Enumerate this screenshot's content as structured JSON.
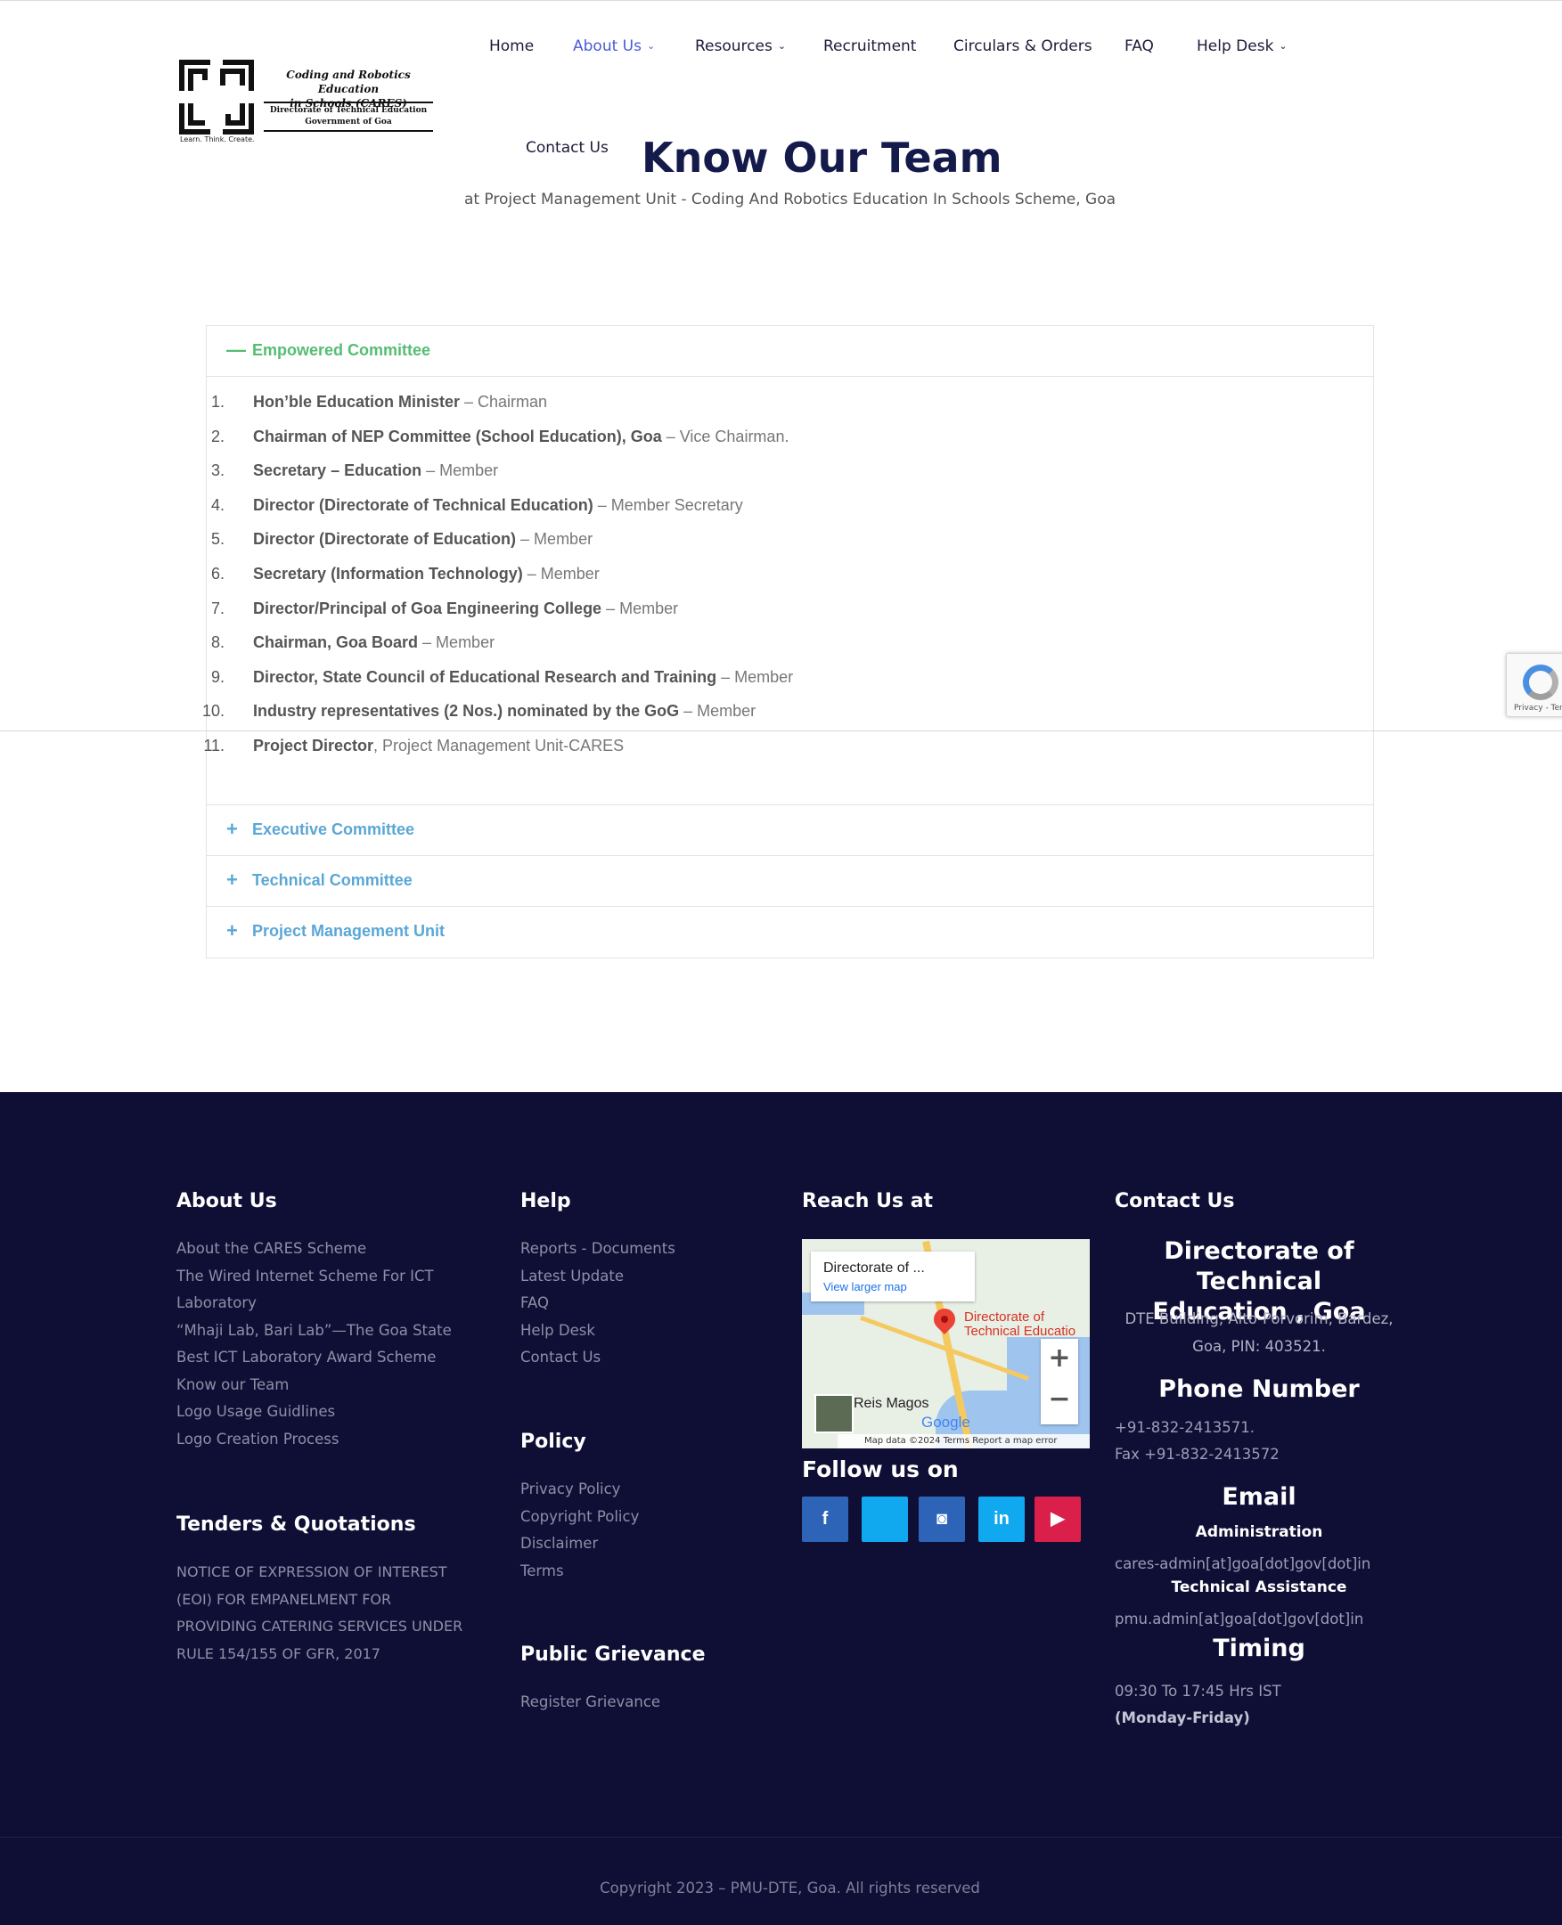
{
  "logo": {
    "title_line1": "Coding and Robotics Education",
    "title_line2": "in Schools (CARES)",
    "sub_line1": "Directorate of Technical Education",
    "sub_line2": "Government of Goa",
    "tagline": "Learn. Think. Create."
  },
  "nav": {
    "home": "Home",
    "about": "About Us",
    "resources": "Resources",
    "recruitment": "Recruitment",
    "circulars": "Circulars & Orders",
    "faq": "FAQ",
    "helpdesk": "Help Desk",
    "contact": "Contact Us",
    "active_color": "#4a5bd4"
  },
  "hero": {
    "title": "Know Our Team",
    "subtitle": "at Project Management Unit - Coding And Robotics Education In Schools Scheme, Goa"
  },
  "accordion": {
    "open_panel": {
      "title": "Empowered Committee",
      "icon": "minus-icon",
      "items": [
        {
          "num": "1.",
          "role": "Hon’ble Education Minister",
          "desc": " – Chairman"
        },
        {
          "num": "2.",
          "role": "Chairman of NEP Committee (School Education), Goa",
          "desc": " – Vice Chairman."
        },
        {
          "num": "3.",
          "role": "Secretary – Education",
          "desc": " – Member"
        },
        {
          "num": "4.",
          "role": "Director (Directorate of Technical Education)",
          "desc": " – Member Secretary"
        },
        {
          "num": "5.",
          "role": "Director (Directorate of Education)",
          "desc": " – Member"
        },
        {
          "num": "6.",
          "role": "Secretary (Information Technology)",
          "desc": " – Member"
        },
        {
          "num": "7.",
          "role": "Director/Principal of Goa Engineering College",
          "desc": " – Member"
        },
        {
          "num": "8.",
          "role": "Chairman, Goa Board",
          "desc": " – Member"
        },
        {
          "num": "9.",
          "role": "Director, State Council of Educational Research and Training",
          "desc": " – Member"
        },
        {
          "num": "10.",
          "role": "Industry representatives (2 Nos.) nominated by the GoG",
          "desc": " – Member"
        },
        {
          "num": "11.",
          "role": "Project Director",
          "desc": ", Project Management Unit-CARES"
        }
      ]
    },
    "closed_panels": [
      {
        "title": "Executive Committee",
        "icon": "plus-icon"
      },
      {
        "title": "Technical Committee",
        "icon": "plus-icon"
      },
      {
        "title": "Project Management Unit",
        "icon": "plus-icon"
      }
    ],
    "open_color": "#56bd72",
    "closed_color": "#5aa7d6"
  },
  "recaptcha": {
    "text": "Privacy - Terms"
  },
  "footer": {
    "about": {
      "heading": "About Us",
      "links": [
        "About the CARES Scheme",
        "The Wired Internet Scheme For ICT",
        "Laboratory",
        "“Mhaji Lab, Bari Lab”—The Goa State",
        "Best ICT Laboratory Award Scheme",
        "Know our Team",
        "Logo Usage Guidlines",
        "Logo Creation Process"
      ]
    },
    "tenders": {
      "heading": "Tenders & Quotations",
      "lines": [
        "NOTICE OF EXPRESSION OF INTEREST",
        "(EOI) FOR EMPANELMENT FOR",
        "PROVIDING CATERING SERVICES UNDER",
        "RULE 154/155 OF GFR, 2017"
      ]
    },
    "help": {
      "heading": "Help",
      "links": [
        "Reports - Documents",
        "Latest Update",
        "FAQ",
        "Help Desk",
        "Contact Us"
      ]
    },
    "policy": {
      "heading": "Policy",
      "links": [
        "Privacy Policy",
        "Copyright Policy",
        "Disclaimer",
        "Terms"
      ]
    },
    "grievance": {
      "heading": "Public Grievance",
      "links": [
        "Register Grievance"
      ]
    },
    "reach": {
      "heading": "Reach Us at",
      "map_card_title": "Directorate of ...",
      "map_card_link": "View larger map",
      "map_place_label_1": "Directorate of",
      "map_place_label_2": "Technical Educatio",
      "map_area": "Reis Magos",
      "map_brand": "Google",
      "map_footer": "Map data ©2024    Terms    Report a map error",
      "zoom_in": "+",
      "zoom_out": "−"
    },
    "follow": {
      "heading": "Follow us on",
      "icons": [
        {
          "name": "facebook-icon",
          "glyph": "f",
          "color": "#2d64b8"
        },
        {
          "name": "twitter-icon",
          "glyph": "",
          "color": "#10a8ee"
        },
        {
          "name": "instagram-icon",
          "glyph": "◙",
          "color": "#2d64b8"
        },
        {
          "name": "linkedin-icon",
          "glyph": "in",
          "color": "#10a8ee"
        },
        {
          "name": "youtube-icon",
          "glyph": "▶",
          "color": "#d91f4a"
        }
      ]
    },
    "contact": {
      "heading": "Contact Us",
      "org_line1": "Directorate of Technical",
      "org_line2": "Education , Goa",
      "address_line1": "DTE Building, Alto-Porvorim, Bardez,",
      "address_line2": "Goa, PIN: 403521.",
      "phone_heading": "Phone Number",
      "phone": "+91-832-2413571.",
      "fax": "Fax +91-832-2413572",
      "email_heading": "Email",
      "admin_label": "Administration",
      "admin_email": "cares-admin[at]goa[dot]gov[dot]in",
      "tech_label": "Technical Assistance",
      "tech_email": "pmu.admin[at]goa[dot]gov[dot]in",
      "timing_heading": "Timing",
      "timing": "09:30 To 17:45 Hrs IST",
      "days": "(Monday-Friday)"
    },
    "copyright": "Copyright 2023 – PMU-DTE, Goa. All rights reserved"
  }
}
